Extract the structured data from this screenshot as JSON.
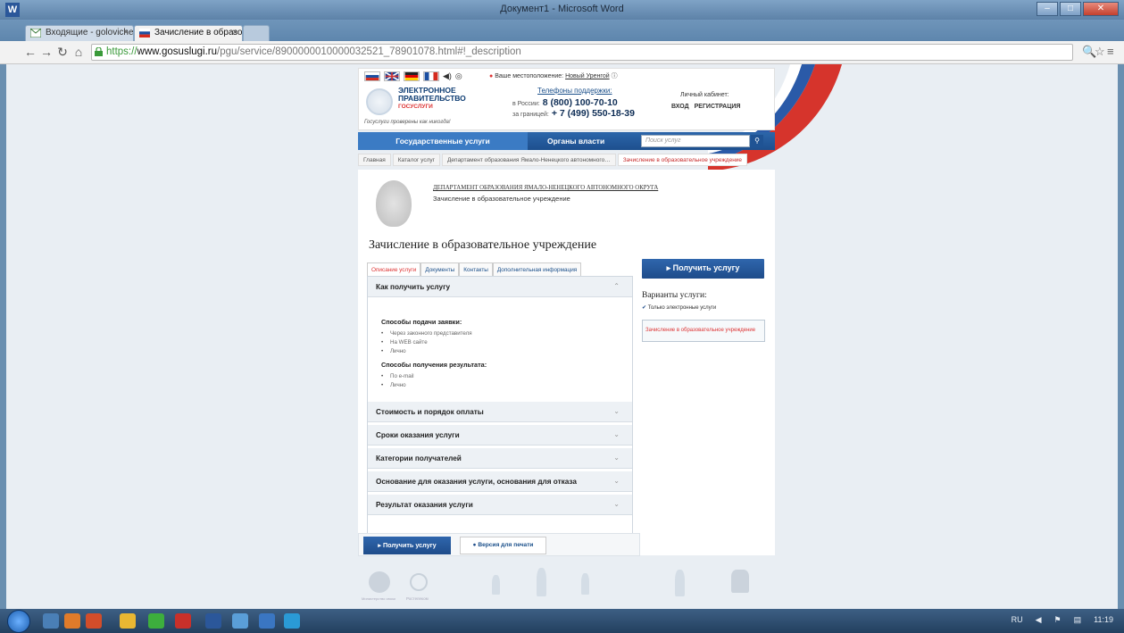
{
  "window": {
    "title": "Документ1 - Microsoft Word"
  },
  "tabs": [
    {
      "label": "Входящие - golovicherg…",
      "close": "×"
    },
    {
      "label": "Зачисление в образоват…",
      "close": "×"
    }
  ],
  "address": {
    "scheme": "https://",
    "host": "www.gosuslugi.ru",
    "path": "/pgu/service/8900000010000032521_78901078.html#!_description"
  },
  "header": {
    "location_label": "Ваше местоположение:",
    "location_city": "Новый Уренгой",
    "logo_line1": "ЭЛЕКТРОННОЕ",
    "logo_line2": "ПРАВИТЕЛЬСТВО",
    "logo_line3": "ГОСУСЛУГИ",
    "slogan": "Госуслуги проверены как никогда!",
    "support_title": "Телефоны поддержки:",
    "support_ru_label": "в России:",
    "support_ru_number": "8 (800) 100-70-10",
    "support_abroad_label": "за границей:",
    "support_abroad_number": "+ 7 (499) 550-18-39",
    "cabinet_label": "Личный кабинет:",
    "login": "ВХОД",
    "register": "РЕГИСТРАЦИЯ"
  },
  "nav": {
    "services": "Государственные услуги",
    "authorities": "Органы власти",
    "search_placeholder": "Поиск услуг",
    "search_icon": "🔍"
  },
  "breadcrumbs": [
    "Главная",
    "Каталог услуг",
    "Департамент образования Ямало-Ненецкого автономного…",
    "Зачисление в образовательное учреждение"
  ],
  "department": {
    "name": "ДЕПАРТАМЕНТ ОБРАЗОВАНИЯ ЯМАЛО-НЕНЕЦКОГО АВТОНОМНОГО ОКРУГА",
    "service": "Зачисление в образовательное учреждение"
  },
  "page_title": "Зачисление в образовательное учреждение",
  "content_tabs": [
    "Описание услуги",
    "Документы",
    "Контакты",
    "Дополнительная информация"
  ],
  "accordion": {
    "open_title": "Как получить услугу",
    "submit_title": "Способы подачи заявки:",
    "submit_methods": [
      "Через законного представителя",
      "На WEB сайте",
      "Лично"
    ],
    "result_title": "Способы получения результата:",
    "result_methods": [
      "По e-mail",
      "Лично"
    ],
    "collapsed": [
      "Стоимость и порядок оплаты",
      "Сроки оказания услуги",
      "Категории получателей",
      "Основание для оказания услуги, основания для отказа",
      "Результат оказания услуги"
    ]
  },
  "side": {
    "get_service": "▸ Получить услугу",
    "variants_title": "Варианты услуги:",
    "only_electronic": "Только электронные услуги",
    "variant_item": "Зачисление в образовательное учреждение"
  },
  "bottom": {
    "get_service": "▸ Получить услугу",
    "print": "Версия для печати"
  },
  "footer": {
    "ministry": "Министерство связи",
    "rostelecom": "Ростелеком"
  },
  "taskbar": {
    "lang": "RU",
    "time": "11:19"
  },
  "colors": {
    "brand_blue": "#1e4c8a",
    "accent_red": "#d33",
    "page_bg": "#e9eef3"
  }
}
